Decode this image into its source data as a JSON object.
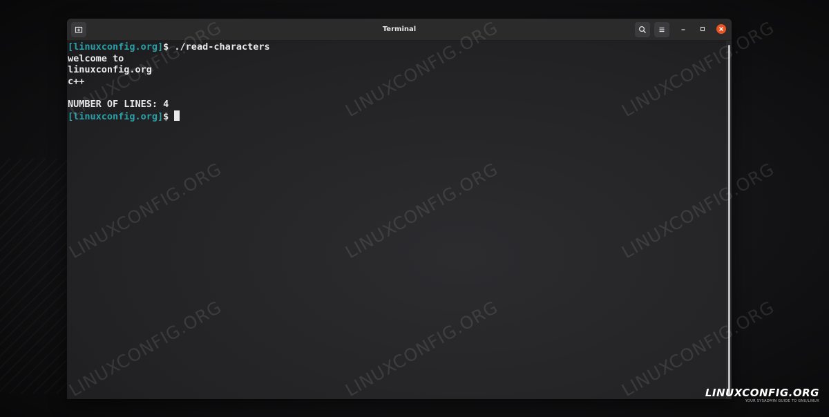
{
  "window": {
    "title": "Terminal"
  },
  "icons": {
    "new_tab": "new-tab-icon",
    "search": "search-icon",
    "menu": "hamburger-menu-icon",
    "minimize": "minimize-icon",
    "maximize": "maximize-icon",
    "close": "close-icon"
  },
  "colors": {
    "prompt": "#2aa1a8",
    "text": "#e9e9e9",
    "close_button": "#e95420"
  },
  "terminal": {
    "lines": [
      {
        "prompt": "[linuxconfig.org]",
        "text": "$ ./read-characters"
      },
      {
        "prompt": "",
        "text": "welcome to"
      },
      {
        "prompt": "",
        "text": "linuxconfig.org"
      },
      {
        "prompt": "",
        "text": "c++"
      },
      {
        "prompt": "",
        "text": ""
      },
      {
        "prompt": "",
        "text": "NUMBER OF LINES: 4"
      },
      {
        "prompt": "[linuxconfig.org]",
        "text": "$ "
      }
    ]
  },
  "watermark": {
    "text": "LINUXCONFIG.ORG"
  },
  "logo": {
    "text": "LINUXCONFIG.ORG",
    "tagline": "YOUR SYSADMIN GUIDE TO GNU/LINUX"
  }
}
